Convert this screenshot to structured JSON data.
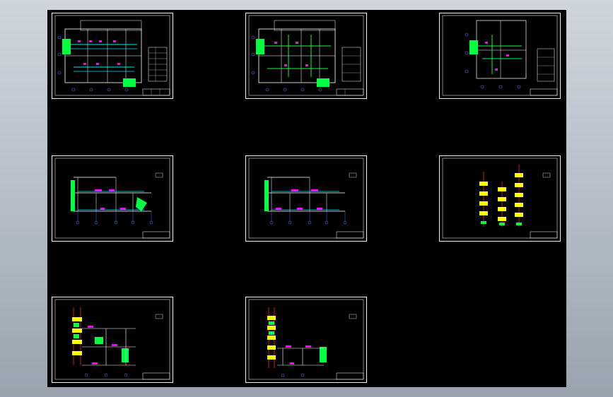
{
  "viewport": {
    "background": "#000000",
    "sheet_count": 8
  },
  "drawing_colors": {
    "frame": "#f2f2f2",
    "wall": "#ffffff",
    "pipe_cyan": "#00e5ff",
    "pipe_green": "#00ff40",
    "fixture_magenta": "#ff00ff",
    "riser_yellow": "#ffff00",
    "riser_red": "#ff2020",
    "axis_blue": "#4a7bff"
  },
  "sheets": [
    {
      "id": "sheet-1",
      "kind": "floor-plan"
    },
    {
      "id": "sheet-2",
      "kind": "floor-plan"
    },
    {
      "id": "sheet-3",
      "kind": "floor-plan"
    },
    {
      "id": "sheet-4",
      "kind": "elevation"
    },
    {
      "id": "sheet-5",
      "kind": "elevation"
    },
    {
      "id": "sheet-6",
      "kind": "riser-diagram"
    },
    {
      "id": "sheet-7",
      "kind": "elevation"
    },
    {
      "id": "sheet-8",
      "kind": "elevation"
    }
  ]
}
